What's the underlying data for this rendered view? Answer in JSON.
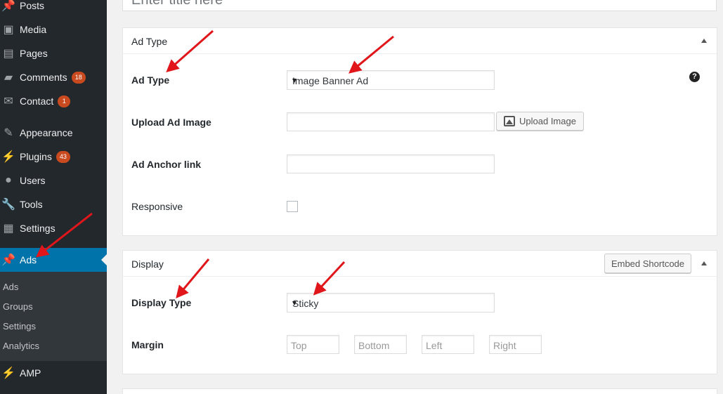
{
  "sidebar": {
    "items": [
      {
        "label": "Posts",
        "icon": "pushpin-icon"
      },
      {
        "label": "Media",
        "icon": "media-icon"
      },
      {
        "label": "Pages",
        "icon": "pages-icon"
      },
      {
        "label": "Comments",
        "icon": "comment-icon",
        "badge": "18"
      },
      {
        "label": "Contact",
        "icon": "mail-icon",
        "badge": "1"
      },
      {
        "label": "Appearance",
        "icon": "brush-icon"
      },
      {
        "label": "Plugins",
        "icon": "plugin-icon",
        "badge": "43"
      },
      {
        "label": "Users",
        "icon": "user-icon"
      },
      {
        "label": "Tools",
        "icon": "wrench-icon"
      },
      {
        "label": "Settings",
        "icon": "settings-icon"
      },
      {
        "label": "Ads",
        "icon": "pushpin-icon",
        "active": true
      },
      {
        "label": "AMP",
        "icon": "amp-icon"
      }
    ],
    "submenu": [
      "Ads",
      "Groups",
      "Settings",
      "Analytics"
    ]
  },
  "title_placeholder": "Enter title here",
  "ad_type_box": {
    "heading": "Ad Type",
    "fields": {
      "ad_type_label": "Ad Type",
      "ad_type_value": "Image Banner Ad",
      "upload_label": "Upload Ad Image",
      "upload_button": "Upload Image",
      "anchor_label": "Ad Anchor link",
      "responsive_label": "Responsive"
    },
    "help_glyph": "?"
  },
  "display_box": {
    "heading": "Display",
    "embed_button": "Embed Shortcode",
    "display_type_label": "Display Type",
    "display_type_value": "Sticky",
    "margin_label": "Margin",
    "margin_placeholders": [
      "Top",
      "Bottom",
      "Left",
      "Right"
    ]
  },
  "colors": {
    "sidebar_bg": "#23282d",
    "active_bg": "#0073aa",
    "badge_bg": "#ca4a1f",
    "annotation_arrow": "#e0161b"
  }
}
